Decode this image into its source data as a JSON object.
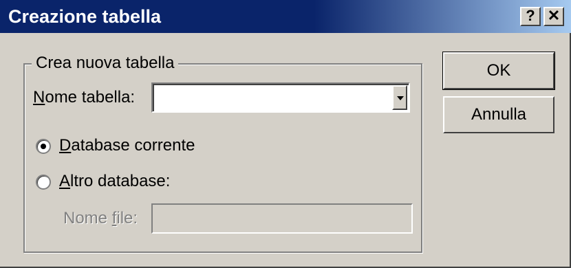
{
  "window": {
    "title": "Creazione tabella",
    "help_glyph": "?",
    "close_glyph": "✕"
  },
  "group": {
    "legend": "Crea nuova tabella",
    "table_name": {
      "label_u": "N",
      "label_rest": "ome tabella:",
      "value": ""
    },
    "radio_current": {
      "label_u": "D",
      "label_rest": "atabase corrente",
      "selected": true
    },
    "radio_other": {
      "label_u": "A",
      "label_rest": "ltro database:",
      "selected": false
    },
    "file_name": {
      "label_pre": "Nome ",
      "label_u": "f",
      "label_rest": "ile:",
      "value": ""
    }
  },
  "buttons": {
    "ok": "OK",
    "cancel": "Annulla"
  }
}
